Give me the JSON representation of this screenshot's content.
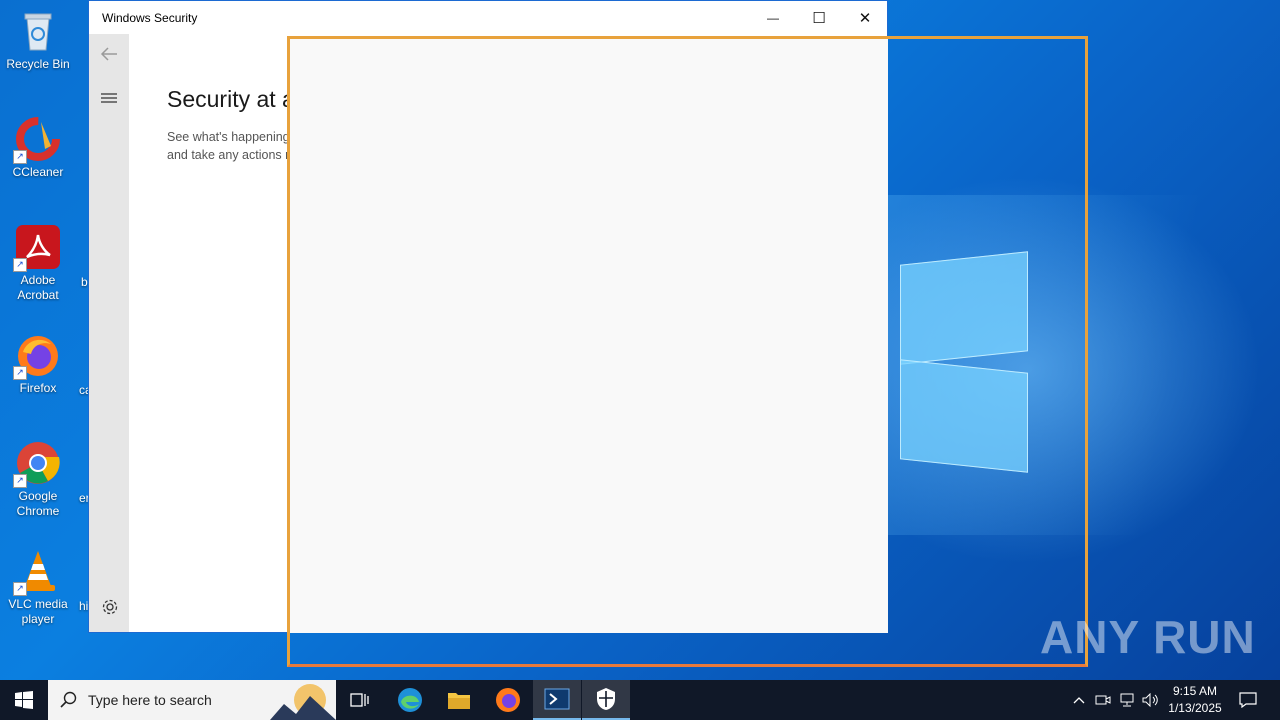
{
  "desktop": {
    "icons": [
      {
        "label": "Recycle Bin"
      },
      {
        "label": "CCleaner"
      },
      {
        "label": "Adobe Acrobat"
      },
      {
        "label": "Firefox"
      },
      {
        "label": "Google Chrome"
      },
      {
        "label": "VLC media player"
      }
    ],
    "partial_labels": [
      "b",
      "ca",
      "er",
      "hi"
    ],
    "watermark": "ANY RUN"
  },
  "window": {
    "title": "Windows Security",
    "minimize_glyph": "—",
    "maximize_glyph": "☐",
    "close_glyph": "✕",
    "heading": "Security at a glance",
    "subtext": "See what's happening with the security and health of your device and take any actions needed."
  },
  "taskbar": {
    "search_placeholder": "Type here to search",
    "clock_time": "9:15 AM",
    "clock_date": "1/13/2025"
  },
  "colors": {
    "accent_orange": "#e8a23c",
    "taskbar_bg": "#101828",
    "desktop_blue": "#0a6fd0"
  }
}
